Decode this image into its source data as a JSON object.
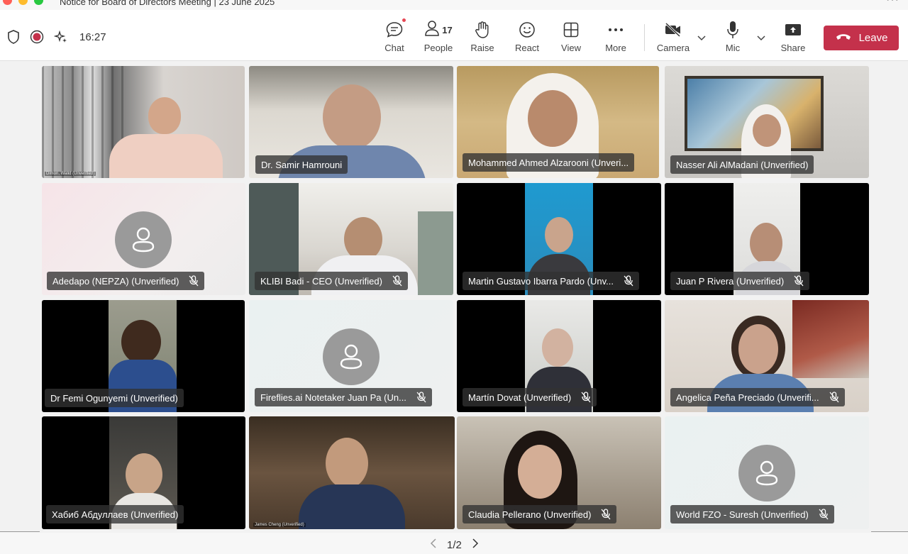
{
  "window": {
    "title": "Notice for Board of Directors Meeting | 23 June 2025"
  },
  "toolbar": {
    "timer": "16:27",
    "chat_label": "Chat",
    "people_label": "People",
    "people_count": "17",
    "raise_label": "Raise",
    "react_label": "React",
    "view_label": "View",
    "more_label": "More",
    "camera_label": "Camera",
    "mic_label": "Mic",
    "share_label": "Share",
    "leave_label": "Leave"
  },
  "participants": [
    {
      "name": "Dimon, Walid (Unverified)",
      "muted": false
    },
    {
      "name": "Dr. Samir Hamrouni",
      "muted": false
    },
    {
      "name": "Mohammed Ahmed Alzarooni (Unveri...",
      "muted": false
    },
    {
      "name": "Nasser Ali AlMadani (Unverified)",
      "muted": false
    },
    {
      "name": "Adedapo (NEPZA) (Unverified)",
      "muted": true
    },
    {
      "name": "KLIBI Badi - CEO (Unverified)",
      "muted": true
    },
    {
      "name": "Martin Gustavo Ibarra Pardo (Unv...",
      "muted": true
    },
    {
      "name": "Juan P Rivera (Unverified)",
      "muted": true
    },
    {
      "name": "Dr Femi Ogunyemi (Unverified)",
      "muted": false
    },
    {
      "name": "Fireflies.ai Notetaker Juan Pa (Un...",
      "muted": true
    },
    {
      "name": "Martín Dovat (Unverified)",
      "muted": true
    },
    {
      "name": "Angelica Peña Preciado (Unverifi...",
      "muted": true
    },
    {
      "name": "Хабиб Абдуллаев (Unverified)",
      "muted": false
    },
    {
      "name": "James Cheng (Unverified)",
      "muted": false
    },
    {
      "name": "Claudia Pellerano (Unverified)",
      "muted": true
    },
    {
      "name": "World FZO - Suresh (Unverified)",
      "muted": true
    }
  ],
  "pagination": {
    "label": "1/2"
  },
  "colors": {
    "leave": "#c4314b",
    "accent_red_dot": "#e74856"
  }
}
